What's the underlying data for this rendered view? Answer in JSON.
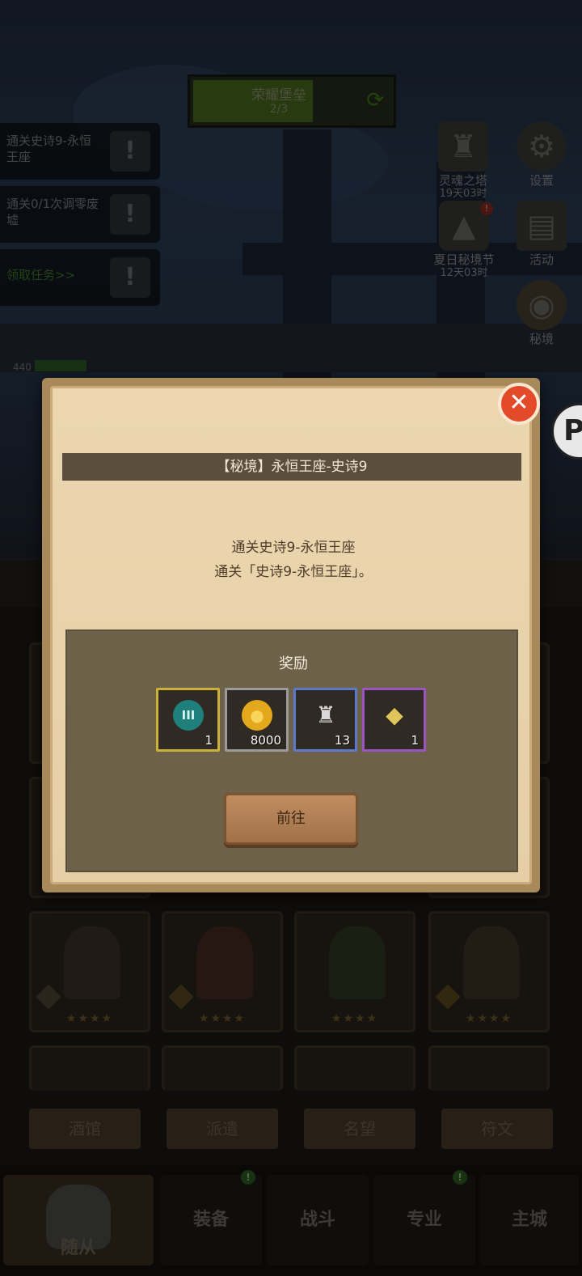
{
  "banner": {
    "title": "荣耀堡垒",
    "progress_text": "2/3",
    "progress": 0.6
  },
  "quests": [
    {
      "text": "通关史诗9-永恒王座",
      "button": "!"
    },
    {
      "text": "通关0/1次调零废墟",
      "button": "!"
    },
    {
      "text": "领取任务>>",
      "button": "!"
    }
  ],
  "side_icons": {
    "soul_tower": {
      "label": "灵魂之塔",
      "timer": "19天03时"
    },
    "settings": {
      "label": "设置"
    },
    "festival": {
      "label": "夏日秘境节",
      "timer": "12天03时",
      "badge": "!"
    },
    "activity": {
      "label": "活动"
    },
    "secret": {
      "label": "秘境"
    }
  },
  "hp": {
    "value": "440"
  },
  "dialog": {
    "title": "【秘境】永恒王座-史诗9",
    "desc_line1": "通关史诗9-永恒王座",
    "desc_line2": "通关「史诗9-永恒王座」。",
    "reward_title": "奖励",
    "rewards": [
      {
        "icon": "rune-token-icon",
        "glyph": "III",
        "count": "1",
        "frame_color": "#c9b13a"
      },
      {
        "icon": "gold-coin-icon",
        "glyph": "●",
        "count": "8000",
        "frame_color": "#9a9a9a"
      },
      {
        "icon": "helmet-icon",
        "glyph": "♜",
        "count": "13",
        "frame_color": "#5d79c9"
      },
      {
        "icon": "gem-icon",
        "glyph": "◆",
        "count": "1",
        "frame_color": "#9a55c0"
      }
    ],
    "go_button": "前往",
    "close_glyph": "✕"
  },
  "tabs": [
    "酒馆",
    "派遣",
    "名望",
    "符文"
  ],
  "bottom_nav": [
    {
      "label": "随从",
      "active": true
    },
    {
      "label": "装备",
      "dot": "!"
    },
    {
      "label": "战斗"
    },
    {
      "label": "专业",
      "dot": "!"
    },
    {
      "label": "主城"
    }
  ],
  "colors": {
    "dialog_bg": "#ebd6b0",
    "title_bar": "#5c4e3d",
    "close_red": "#e24a2a",
    "button_brown": "#b07e54"
  }
}
